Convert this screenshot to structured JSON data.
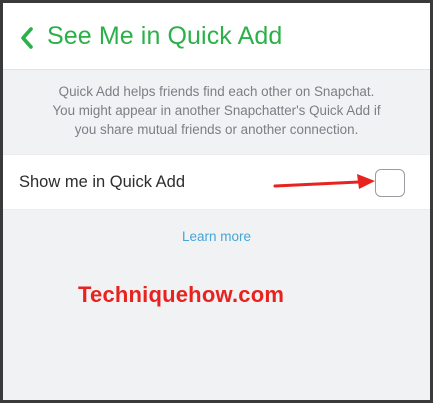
{
  "header": {
    "title": "See Me in Quick Add",
    "back_icon": "chevron-left-icon",
    "accent_color": "#2bb04a"
  },
  "description": {
    "lines": [
      "Quick Add helps friends find each other on Snapchat.",
      "You might appear in another Snapchatter's Quick Add if",
      "you share mutual friends or another connection."
    ]
  },
  "setting": {
    "label": "Show me in Quick Add",
    "checked": false
  },
  "learn_more": {
    "label": "Learn more",
    "color": "#45a4d8"
  },
  "annotation": {
    "arrow_color": "#e8231f",
    "watermark": "Techniquehow.com"
  }
}
